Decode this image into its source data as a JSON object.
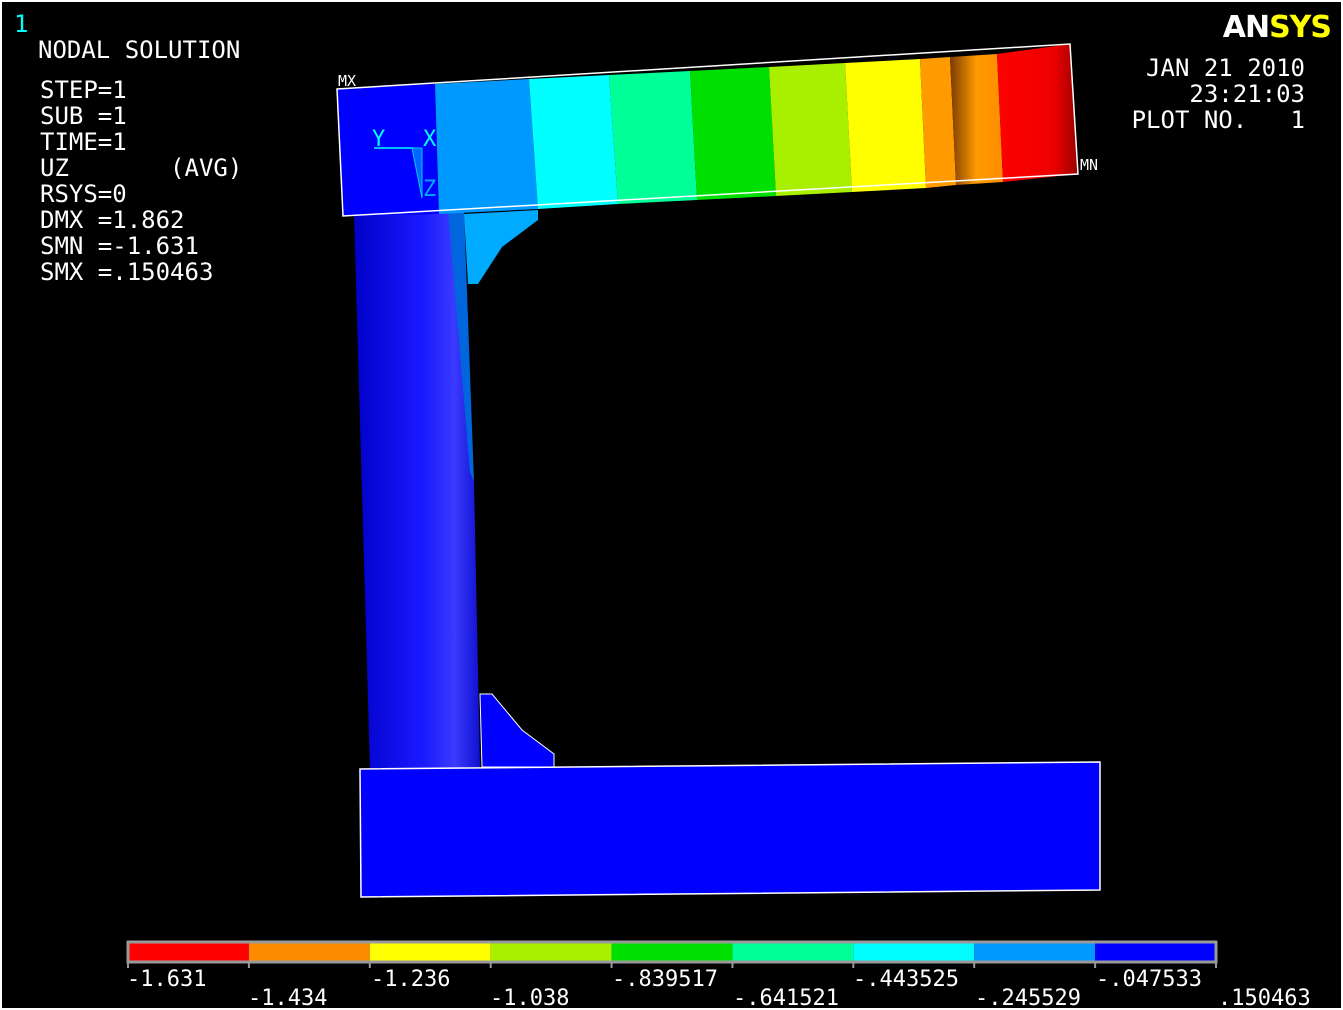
{
  "window": {
    "number": "1"
  },
  "logo": {
    "part1": "AN",
    "part2": "SYS"
  },
  "header": {
    "title": "NODAL SOLUTION",
    "lines": [
      "STEP=1",
      "SUB =1",
      "TIME=1",
      "UZ       (AVG)",
      "RSYS=0",
      "DMX =1.862",
      "SMN =-1.631",
      "SMX =.150463"
    ]
  },
  "stamp": {
    "date": "JAN 21 2010",
    "time": "23:21:03",
    "plot": "PLOT NO.   1"
  },
  "markers": {
    "max": "MX",
    "min": "MN"
  },
  "triad": {
    "y": "Y",
    "x": "X",
    "z": "Z"
  },
  "legend": {
    "colors": [
      "#ff0000",
      "#ff8c00",
      "#ffff00",
      "#a8f000",
      "#00e000",
      "#00ff99",
      "#00ffff",
      "#0099ff",
      "#0000ff"
    ],
    "top_labels": [
      "-1.631",
      "-1.236",
      "-.839517",
      "-.443525",
      "-.047533"
    ],
    "bottom_labels": [
      "-1.434",
      "-1.038",
      "-.641521",
      "-.245529",
      ".150463"
    ]
  }
}
